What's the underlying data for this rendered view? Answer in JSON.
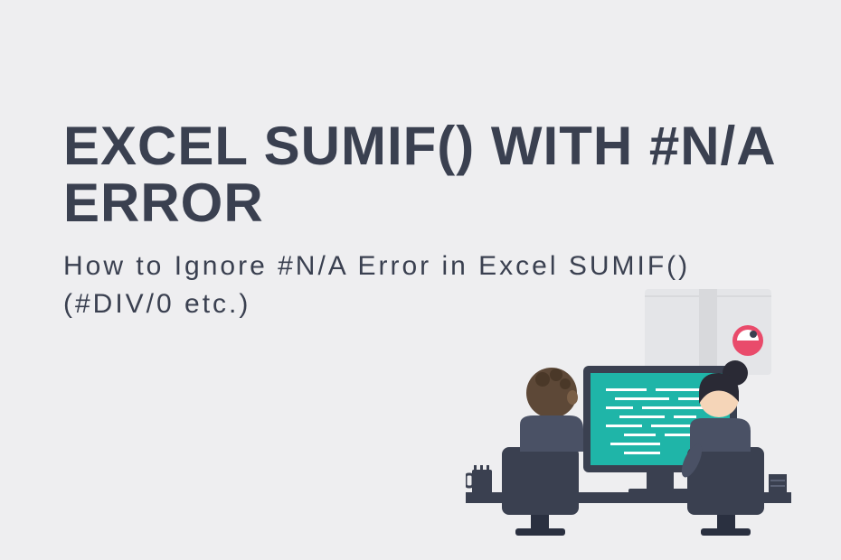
{
  "title": "EXCEL SUMIF() WITH #N/A ERROR",
  "subtitle": "How to Ignore #N/A Error in Excel SUMIF() (#DIV/0 etc.)"
}
